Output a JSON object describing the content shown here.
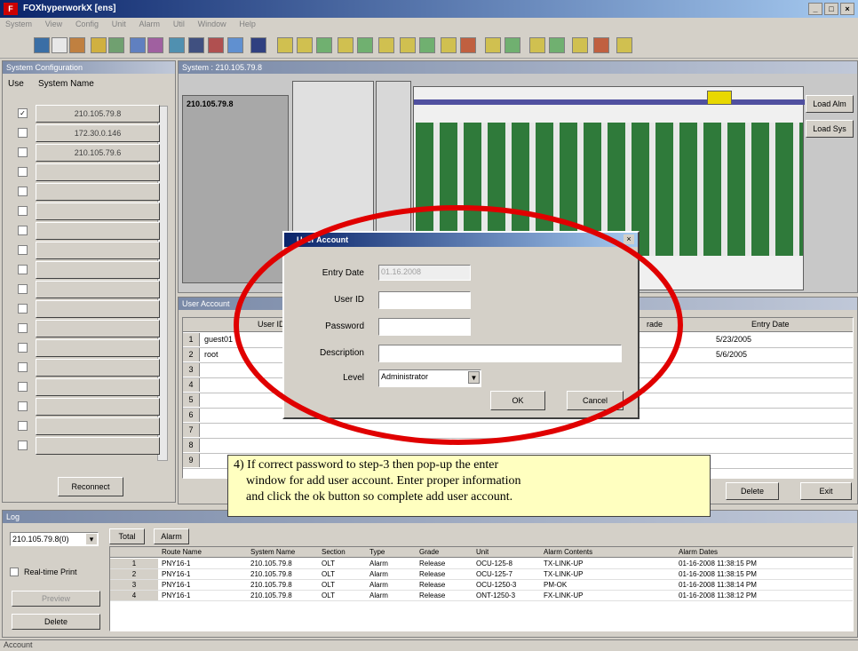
{
  "window": {
    "title": "FOXhyperworkX [ens]"
  },
  "menubar": {
    "items": [
      "System",
      "View",
      "Config",
      "Unit",
      "Alarm",
      "Util",
      "Window",
      "Help"
    ]
  },
  "system_config": {
    "header": "System Configuration",
    "col_use": "Use",
    "col_name": "System Name",
    "rows": [
      {
        "checked": true,
        "name": "210.105.79.8"
      },
      {
        "checked": false,
        "name": "172.30.0.146"
      },
      {
        "checked": false,
        "name": "210.105.79.6"
      },
      {
        "checked": false,
        "name": ""
      },
      {
        "checked": false,
        "name": ""
      },
      {
        "checked": false,
        "name": ""
      },
      {
        "checked": false,
        "name": ""
      },
      {
        "checked": false,
        "name": ""
      },
      {
        "checked": false,
        "name": ""
      },
      {
        "checked": false,
        "name": ""
      },
      {
        "checked": false,
        "name": ""
      },
      {
        "checked": false,
        "name": ""
      },
      {
        "checked": false,
        "name": ""
      },
      {
        "checked": false,
        "name": ""
      },
      {
        "checked": false,
        "name": ""
      },
      {
        "checked": false,
        "name": ""
      },
      {
        "checked": false,
        "name": ""
      },
      {
        "checked": false,
        "name": ""
      }
    ],
    "reconnect_label": "Reconnect"
  },
  "system_view": {
    "header": "System : 210.105.79.8",
    "system_label": "210.105.79.8",
    "load_alm": "Load Alm",
    "load_sys": "Load Sys"
  },
  "user_accounts": {
    "header": "User Account",
    "col_user": "User ID",
    "col_grade": "rade",
    "col_entry": "Entry Date",
    "rows": [
      {
        "num": "1",
        "user": "guest01",
        "entry": "5/23/2005"
      },
      {
        "num": "2",
        "user": "root",
        "entry": "5/6/2005"
      },
      {
        "num": "3",
        "user": "",
        "entry": ""
      },
      {
        "num": "4",
        "user": "",
        "entry": ""
      },
      {
        "num": "5",
        "user": "",
        "entry": ""
      },
      {
        "num": "6",
        "user": "",
        "entry": ""
      },
      {
        "num": "7",
        "user": "",
        "entry": ""
      },
      {
        "num": "8",
        "user": "",
        "entry": ""
      },
      {
        "num": "9",
        "user": "",
        "entry": ""
      }
    ],
    "delete_label": "Delete",
    "exit_label": "Exit"
  },
  "dialog": {
    "title": "User Account",
    "entry_date_label": "Entry Date",
    "entry_date_value": "01.16.2008",
    "user_id_label": "User ID",
    "password_label": "Password",
    "description_label": "Description",
    "level_label": "Level",
    "level_value": "Administrator",
    "ok_label": "OK",
    "cancel_label": "Cancel"
  },
  "callout": {
    "line1": "4) If correct password to step-3 then pop-up the enter",
    "line2": "window for add user account. Enter proper information",
    "line3": "and click the ok button so complete add user account."
  },
  "log": {
    "header": "Log",
    "system_select": "210.105.79.8(0)",
    "tab_total": "Total",
    "tab_alarm": "Alarm",
    "realtime_label": "Real-time Print",
    "preview_label": "Preview",
    "delete_label": "Delete",
    "columns": [
      "Route Name",
      "System Name",
      "Section",
      "Type",
      "Grade",
      "Unit",
      "Alarm Contents",
      "Alarm Dates"
    ],
    "rows": [
      {
        "num": "1",
        "cells": [
          "PNY16-1",
          "210.105.79.8",
          "OLT",
          "Alarm",
          "Release",
          "OCU-125-8",
          "TX-LINK-UP",
          "01-16-2008 11:38:15 PM"
        ]
      },
      {
        "num": "2",
        "cells": [
          "PNY16-1",
          "210.105.79.8",
          "OLT",
          "Alarm",
          "Release",
          "OCU-125-7",
          "TX-LINK-UP",
          "01-16-2008 11:38:15 PM"
        ]
      },
      {
        "num": "3",
        "cells": [
          "PNY16-1",
          "210.105.79.8",
          "OLT",
          "Alarm",
          "Release",
          "OCU-1250-3",
          "PM-OK",
          "01-16-2008 11:38:14 PM"
        ]
      },
      {
        "num": "4",
        "cells": [
          "PNY16-1",
          "210.105.79.8",
          "OLT",
          "Alarm",
          "Release",
          "ONT-1250-3",
          "FX-LINK-UP",
          "01-16-2008 11:38:12 PM"
        ]
      }
    ]
  },
  "status_bar": {
    "text": "Account"
  },
  "colors": {
    "highlight_ellipse": "#e00000",
    "callout_bg": "#ffffc0",
    "title_blue": "#0a246a"
  }
}
